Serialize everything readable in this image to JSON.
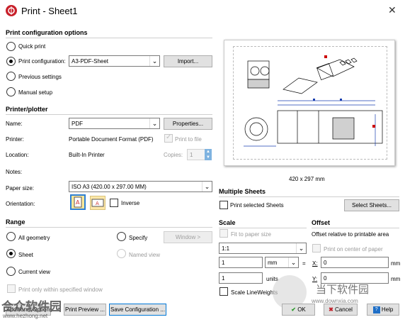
{
  "window": {
    "title": "Print - Sheet1",
    "close": "✕"
  },
  "config": {
    "heading": "Print configuration options",
    "quick_print": "Quick print",
    "print_configuration": "Print configuration:",
    "config_value": "A3-PDF-Sheet",
    "import_button": "Import...",
    "previous_settings": "Previous settings",
    "manual_setup": "Manual setup",
    "selected": "print_configuration"
  },
  "printer": {
    "heading": "Printer/plotter",
    "name_label": "Name:",
    "name_value": "PDF",
    "properties_button": "Properties...",
    "printer_label": "Printer:",
    "printer_value": "Portable Document Format (PDF)",
    "print_to_file": "Print to file",
    "location_label": "Location:",
    "location_value": "Built-In Printer",
    "copies_label": "Copies:",
    "copies_value": "1",
    "notes_label": "Notes:",
    "paper_size_label": "Paper size:",
    "paper_size_value": "ISO A3 (420.00 x 297.00 MM)",
    "orientation_label": "Orientation:",
    "inverse": "Inverse"
  },
  "preview": {
    "size_text": "420 x 297 mm"
  },
  "range": {
    "heading": "Range",
    "all_geometry": "All geometry",
    "specify": "Specify",
    "window_button": "Window >",
    "sheet": "Sheet",
    "named_view": "Named view",
    "current_view": "Current view",
    "print_only_window": "Print only within specified window",
    "selected": "sheet"
  },
  "multiple_sheets": {
    "heading": "Multiple Sheets",
    "print_selected": "Print selected Sheets",
    "select_sheets_button": "Select Sheets..."
  },
  "scale": {
    "heading": "Scale",
    "fit_to_paper": "Fit to paper size",
    "ratio_value": "1:1",
    "value1": "1",
    "unit1": "mm",
    "equals": "=",
    "value2": "1",
    "unit2": "units",
    "scale_lineweights": "Scale LineWeights"
  },
  "offset": {
    "heading": "Offset",
    "relative": "Offset relative to printable area",
    "print_center": "Print on center of paper",
    "x_label": "X:",
    "x_value": "0",
    "x_unit": "mm",
    "y_label": "Y:",
    "y_value": "0",
    "y_unit": "mm"
  },
  "footer": {
    "additional_options": "Additional Options",
    "print_preview": "Print Preview ...",
    "save_configuration": "Save Configuration ...",
    "ok": "OK",
    "cancel": "Cancel",
    "help": "Help"
  },
  "watermark": {
    "cn_left": "合众软件园",
    "url_left": "www.hezhong.net",
    "cn_right": "当下软件园",
    "url_right": "www.downxia.com"
  },
  "colors": {
    "accent": "#0078d7",
    "ok_check": "#2e9c2e",
    "cancel_x": "#c0202a"
  }
}
